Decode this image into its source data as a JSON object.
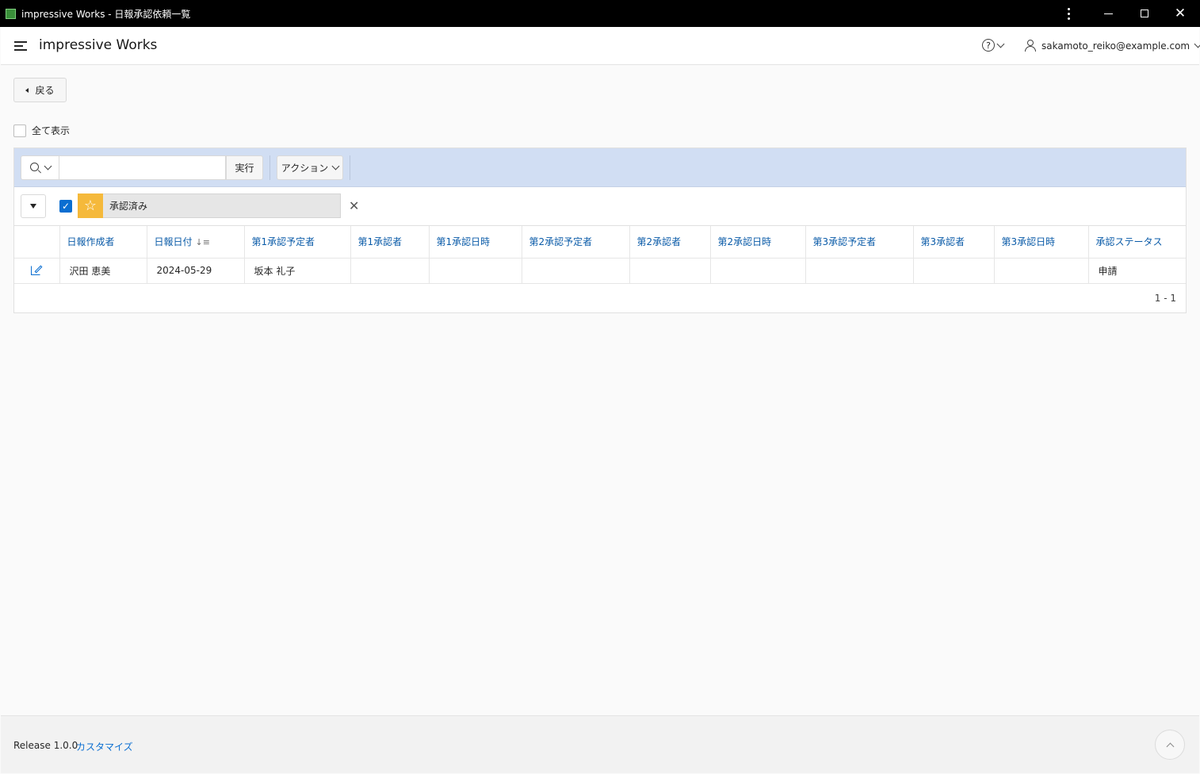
{
  "window": {
    "title": "impressive Works - 日報承認依頼一覧"
  },
  "header": {
    "app_title": "impressive Works",
    "help_icon": "question-circle-icon",
    "user_email": "sakamoto_reiko@example.com"
  },
  "back_button": {
    "label": "戻る"
  },
  "show_all": {
    "label": "全て表示",
    "checked": false
  },
  "toolbar": {
    "search_placeholder": "",
    "search_value": "",
    "go_label": "実行",
    "actions_label": "アクション"
  },
  "filter": {
    "label": "承認済み",
    "enabled": true
  },
  "table": {
    "columns": [
      "日報作成者",
      "日報日付",
      "第1承認予定者",
      "第1承認者",
      "第1承認日時",
      "第2承認予定者",
      "第2承認者",
      "第2承認日時",
      "第3承認予定者",
      "第3承認者",
      "第3承認日時",
      "承認ステータス"
    ],
    "sorted_column": "日報日付",
    "sort_direction": "descending",
    "rows": [
      {
        "creator": "沢田 恵美",
        "date": "2024-05-29",
        "approver1_planned": "坂本 礼子",
        "approver1": "",
        "approved1_at": "",
        "approver2_planned": "",
        "approver2": "",
        "approved2_at": "",
        "approver3_planned": "",
        "approver3": "",
        "approved3_at": "",
        "status": "申請"
      }
    ],
    "pagination": "1 - 1"
  },
  "footer": {
    "release": "Release 1.0.0",
    "customize": "カスタマイズ"
  },
  "colors": {
    "accent": "#0a6ed1",
    "toolbar_bg": "#d1def3",
    "star": "#f5b93b"
  }
}
